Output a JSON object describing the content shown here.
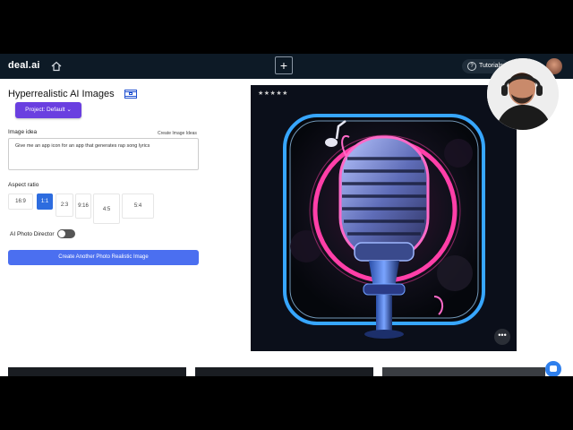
{
  "app": {
    "logo": "deal.ai",
    "tutorials_label": "Tutorials",
    "add_label": "+"
  },
  "page": {
    "title": "Hyperrealistic AI Images",
    "project_button": "Project: Default",
    "image_idea_label": "Image idea",
    "create_ideas_link": "Create Image Ideas",
    "image_idea_value": "Give me an app icon for an app that generates rap song lyrics",
    "aspect_ratio_label": "Aspect ratio",
    "aspect_ratios": [
      {
        "label": "16:9",
        "selected": false
      },
      {
        "label": "1:1",
        "selected": true
      },
      {
        "label": "2:3",
        "selected": false
      },
      {
        "label": "9:16",
        "selected": false
      },
      {
        "label": "4:5",
        "selected": false
      },
      {
        "label": "5:4",
        "selected": false
      }
    ],
    "photo_director_label": "AI Photo Director",
    "photo_director_on": false,
    "create_button": "Create Another Photo Realistic Image"
  },
  "result": {
    "rating_stars": "★★★★★",
    "more_label": "•••"
  },
  "colors": {
    "topbar": "#0d1a26",
    "project_button": "#6a3fe0",
    "primary_button": "#4b6ff0",
    "selected_aspect": "#2d6cdf",
    "neon_pink": "#ff3fa8",
    "neon_blue": "#37a6ff"
  }
}
